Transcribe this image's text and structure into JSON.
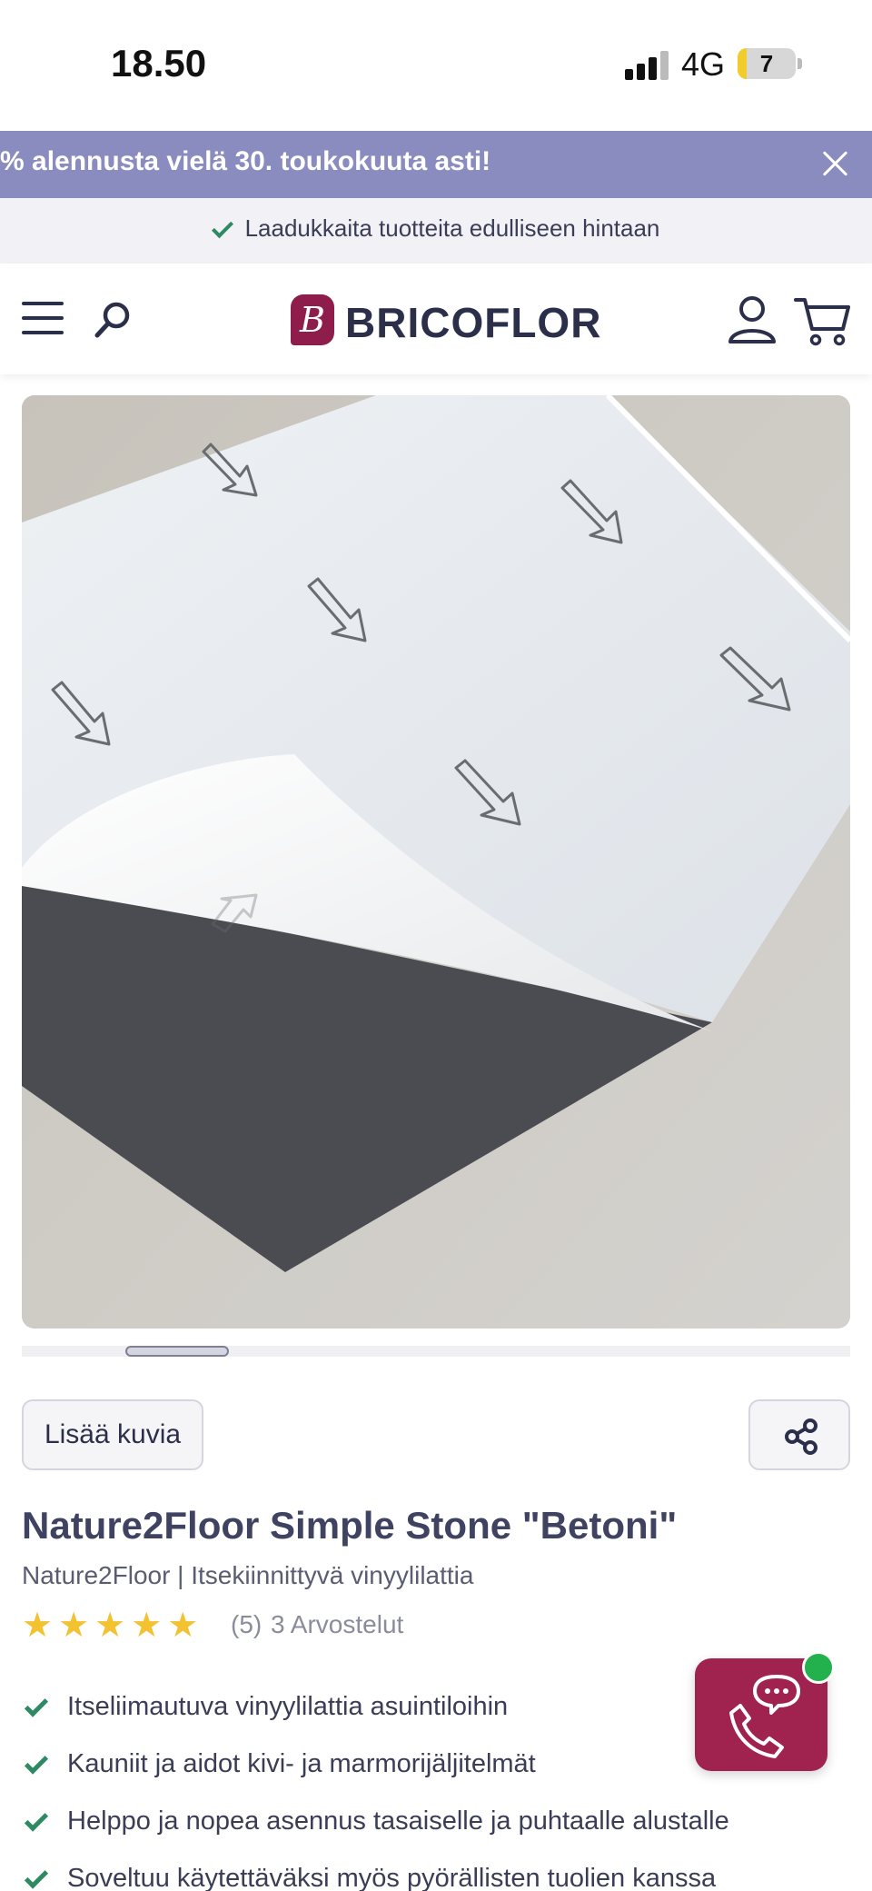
{
  "status_bar": {
    "time": "18.50",
    "network": "4G",
    "battery": "7"
  },
  "promo": {
    "text": "% alennusta vielä 30. toukokuuta asti!",
    "background": "#8a8cbf"
  },
  "quality_strip": {
    "text": "Laadukkaita tuotteita edulliseen hintaan"
  },
  "header": {
    "logo_text": "BRICOFLOR",
    "logo_mark": "B",
    "brand_color": "#8e1d4c",
    "icons": [
      "menu-icon",
      "search-icon",
      "user-icon",
      "cart-icon"
    ]
  },
  "gallery": {
    "more_images_label": "Lisää kuvia",
    "share_icon": "share-icon"
  },
  "product": {
    "title": "Nature2Floor Simple Stone \"Betoni\"",
    "subtitle": "Nature2Floor | Itsekiinnittyvä vinyylilattia",
    "stars": "★★★★★",
    "rating_count": "(5)",
    "reviews_label": "3 Arvostelut",
    "features": [
      "Itseliimautuva vinyylilattia asuintiloihin",
      "Kauniit ja aidot kivi- ja marmorijäljitelmät",
      "Helppo ja nopea asennus tasaiselle ja puhtaalle alustalle",
      "Soveltuu käytettäväksi myös pyörällisten tuolien kanssa"
    ]
  },
  "chat": {
    "icon": "chat-phone-icon",
    "status_color": "#22b14c",
    "background": "#a0224f"
  }
}
